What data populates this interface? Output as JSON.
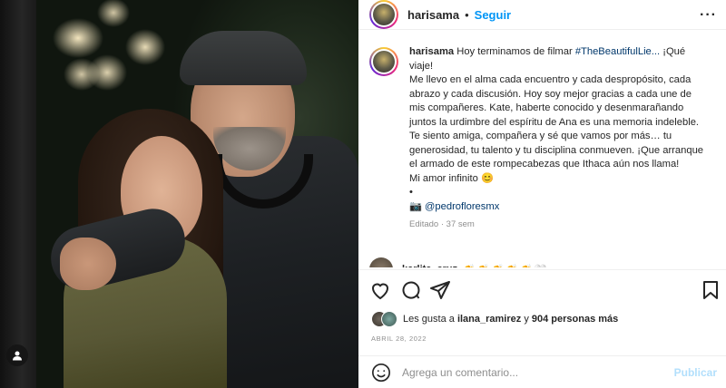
{
  "post": {
    "username": "harisama",
    "dot": "•",
    "follow_label": "Seguir",
    "more_icon": "more-horizontal-icon"
  },
  "caption": {
    "username": "harisama",
    "intro": "Hoy terminamos de filmar",
    "hashtag": "#TheBeautifulLie...",
    "after_hashtag": "¡Qué viaje!",
    "body": "Me llevo en el alma cada encuentro y cada despropósito, cada abrazo y cada discusión. Hoy soy mejor gracias a cada une de mis compañeres. Kate, haberte conocido y desenmarañando juntos la urdimbre del espíritu de Ana es una memoria indeleble. Te siento amiga, compañera y sé que vamos por más… tu generosidad, tu talento y tu disciplina conmueven. ¡Que arranque el armado de este rompecabezas que Ithaca aún nos llama!",
    "closing": "Mi amor infinito 😊",
    "bullet": "•",
    "camera_emoji": "📷",
    "mention": "@pedrofloresmx",
    "edited": "Editado · 37 sem"
  },
  "next_comment": {
    "username": "karlita_cruz",
    "emojis": "👏👏👏👏👏🤍"
  },
  "likes": {
    "prefix": "Les gusta a",
    "user": "ilana_ramirez",
    "connector": "y",
    "count": "904 personas más"
  },
  "date": "ABRIL 28, 2022",
  "comment": {
    "placeholder": "Agrega un comentario...",
    "publish_label": "Publicar",
    "emoji_icon": "smiley-icon"
  },
  "colors": {
    "accent": "#0095f6",
    "link": "#00376b",
    "muted": "#8e8e8e"
  }
}
